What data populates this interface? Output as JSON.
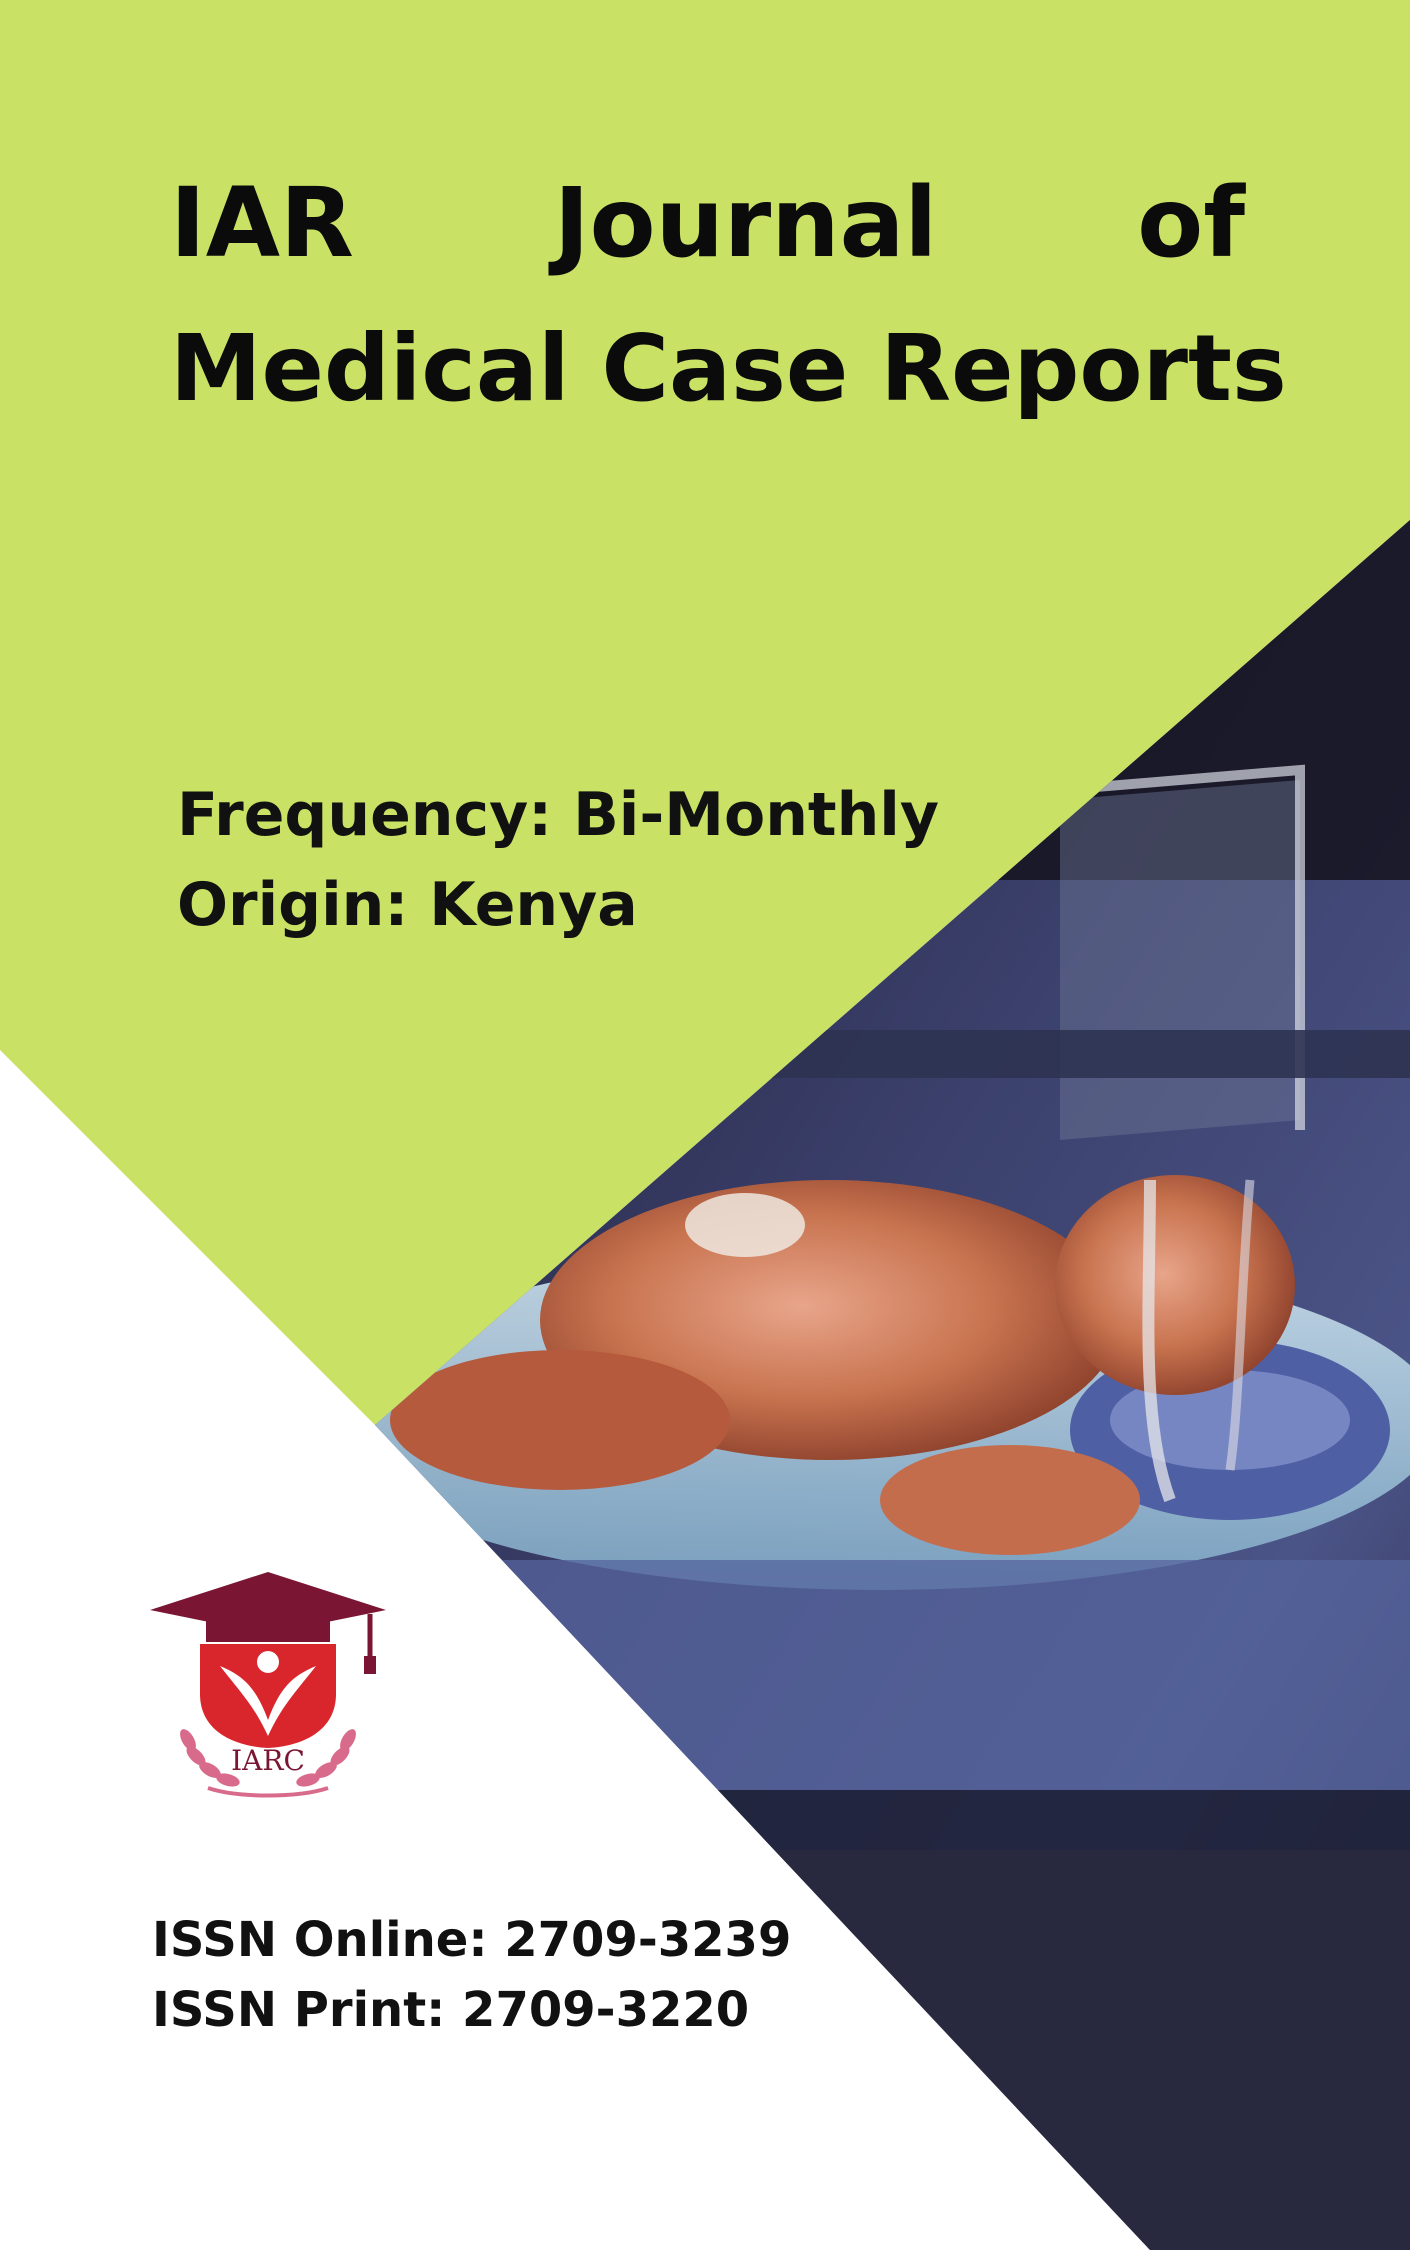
{
  "cover": {
    "title_words": [
      "IAR",
      "Journal",
      "of"
    ],
    "title_line2": "Medical Case Reports",
    "frequency": "Frequency: Bi-Monthly",
    "origin": "Origin: Kenya",
    "issn_online": "ISSN Online: 2709-3239",
    "issn_print": "ISSN Print: 2709-3220"
  },
  "logo": {
    "text": "IARC",
    "icon": "graduation-cap-icon"
  },
  "photo": {
    "subject": "premature infant in incubator"
  },
  "colors": {
    "lime": "#C9E265",
    "white": "#FFFFFF",
    "text": "#0B0B0B",
    "logo_red": "#D8262C",
    "logo_maroon": "#7A1633",
    "logo_pink": "#D86B8C"
  }
}
